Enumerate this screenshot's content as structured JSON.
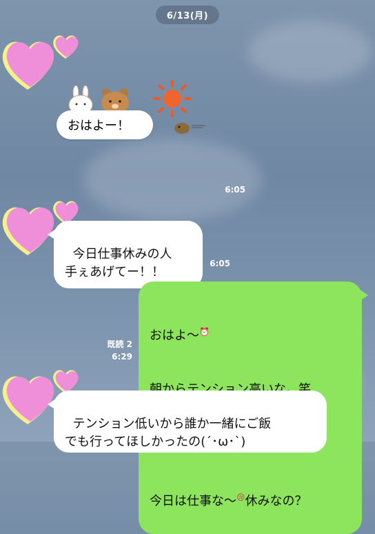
{
  "date_label": "6/13(月)",
  "messages": [
    {
      "id": "m1",
      "type": "sticker",
      "text": "おはよー！",
      "time": "6:05"
    },
    {
      "id": "m2",
      "type": "text",
      "text": "今日仕事休みの人\n手ぇあげてー！！",
      "time": "6:05"
    },
    {
      "id": "m3",
      "type": "text_outgoing",
      "lines": [
        "おはよ〜",
        "朝からテンション高いな。笑",
        "",
        "今日は仕事な〜",
        "休みなの？"
      ],
      "emoji1": "⏰",
      "emoji2": "😢",
      "read_label": "既読 2",
      "time": "6:29"
    },
    {
      "id": "m4",
      "type": "text",
      "text": "テンション低いから誰か一緒にご飯\nでも行ってほしかったの(´･ω･`)"
    }
  ]
}
